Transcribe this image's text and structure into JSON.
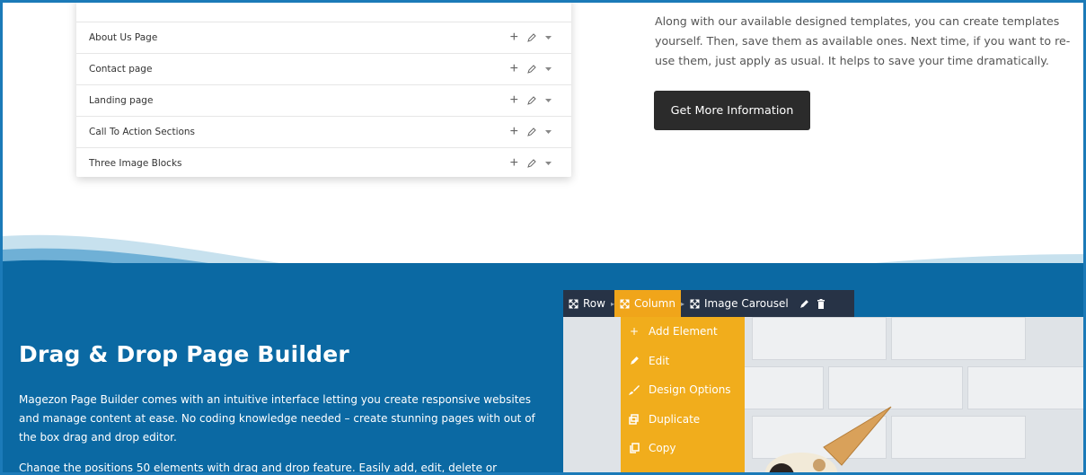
{
  "templates": {
    "rows": [
      {
        "label": "About Us Page"
      },
      {
        "label": "Contact page"
      },
      {
        "label": "Landing page"
      },
      {
        "label": "Call To Action Sections"
      },
      {
        "label": "Three Image Blocks"
      }
    ]
  },
  "intro": {
    "text": "Along with our available designed templates, you can create templates yourself. Then, save them as available ones. Next time, if you want to re-use them, just apply as usual. It helps to save your time dramatically.",
    "cta_label": "Get More Information"
  },
  "section": {
    "title": "Drag & Drop Page Builder",
    "p1": "Magezon Page Builder comes with an intuitive interface letting you create responsive websites and manage content at ease. No coding knowledge needed – create stunning pages with out of the box drag and drop editor.",
    "p2": "Change the positions 50 elements with drag and drop feature. Easily add, edit, delete or"
  },
  "toolbar": {
    "row_label": "Row",
    "column_label": "Column",
    "carousel_label": "Image Carousel"
  },
  "menu": {
    "add_element": "Add Element",
    "edit": "Edit",
    "design_options": "Design Options",
    "duplicate": "Duplicate",
    "copy": "Copy"
  },
  "colors": {
    "section_blue": "#0b69a3",
    "toolbar_dark": "#273346",
    "menu_orange": "#f1ad1c",
    "button_dark": "#2b2b2b"
  }
}
